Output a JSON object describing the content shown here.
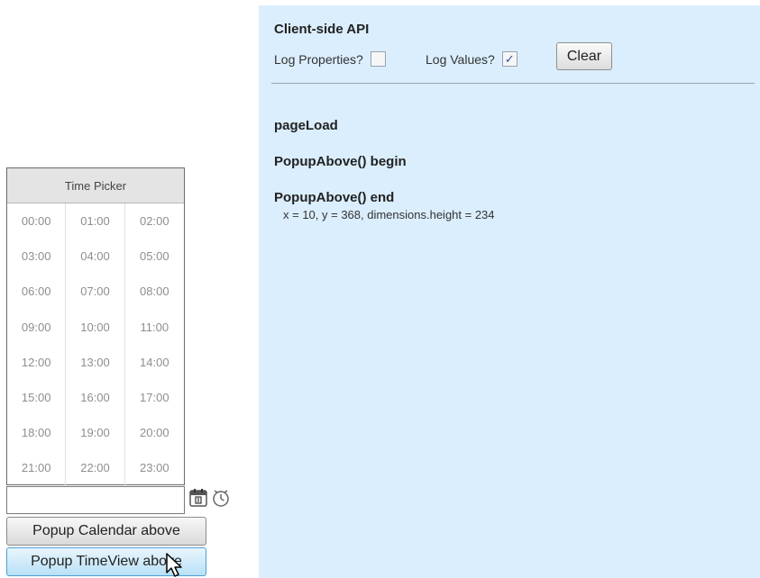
{
  "console": {
    "title": "Client-side API",
    "log_properties_label": "Log Properties?",
    "log_properties_checked": false,
    "log_values_label": "Log Values?",
    "log_values_checked": true,
    "check_mark": "✓",
    "clear_label": "Clear",
    "log": [
      {
        "heading": "pageLoad"
      },
      {
        "heading": "PopupAbove() begin"
      },
      {
        "heading": "PopupAbove() end",
        "detail": "x = 10, y = 368, dimensions.height = 234"
      }
    ]
  },
  "time_picker": {
    "title": "Time Picker",
    "times": [
      "00:00",
      "01:00",
      "02:00",
      "03:00",
      "04:00",
      "05:00",
      "06:00",
      "07:00",
      "08:00",
      "09:00",
      "10:00",
      "11:00",
      "12:00",
      "13:00",
      "14:00",
      "15:00",
      "16:00",
      "17:00",
      "18:00",
      "19:00",
      "20:00",
      "21:00",
      "22:00",
      "23:00"
    ]
  },
  "date_input": {
    "value": ""
  },
  "icons": {
    "calendar": "calendar-icon",
    "clock": "clock-icon"
  },
  "buttons": {
    "popup_calendar": "Popup Calendar above",
    "popup_timeview": "Popup TimeView above"
  }
}
